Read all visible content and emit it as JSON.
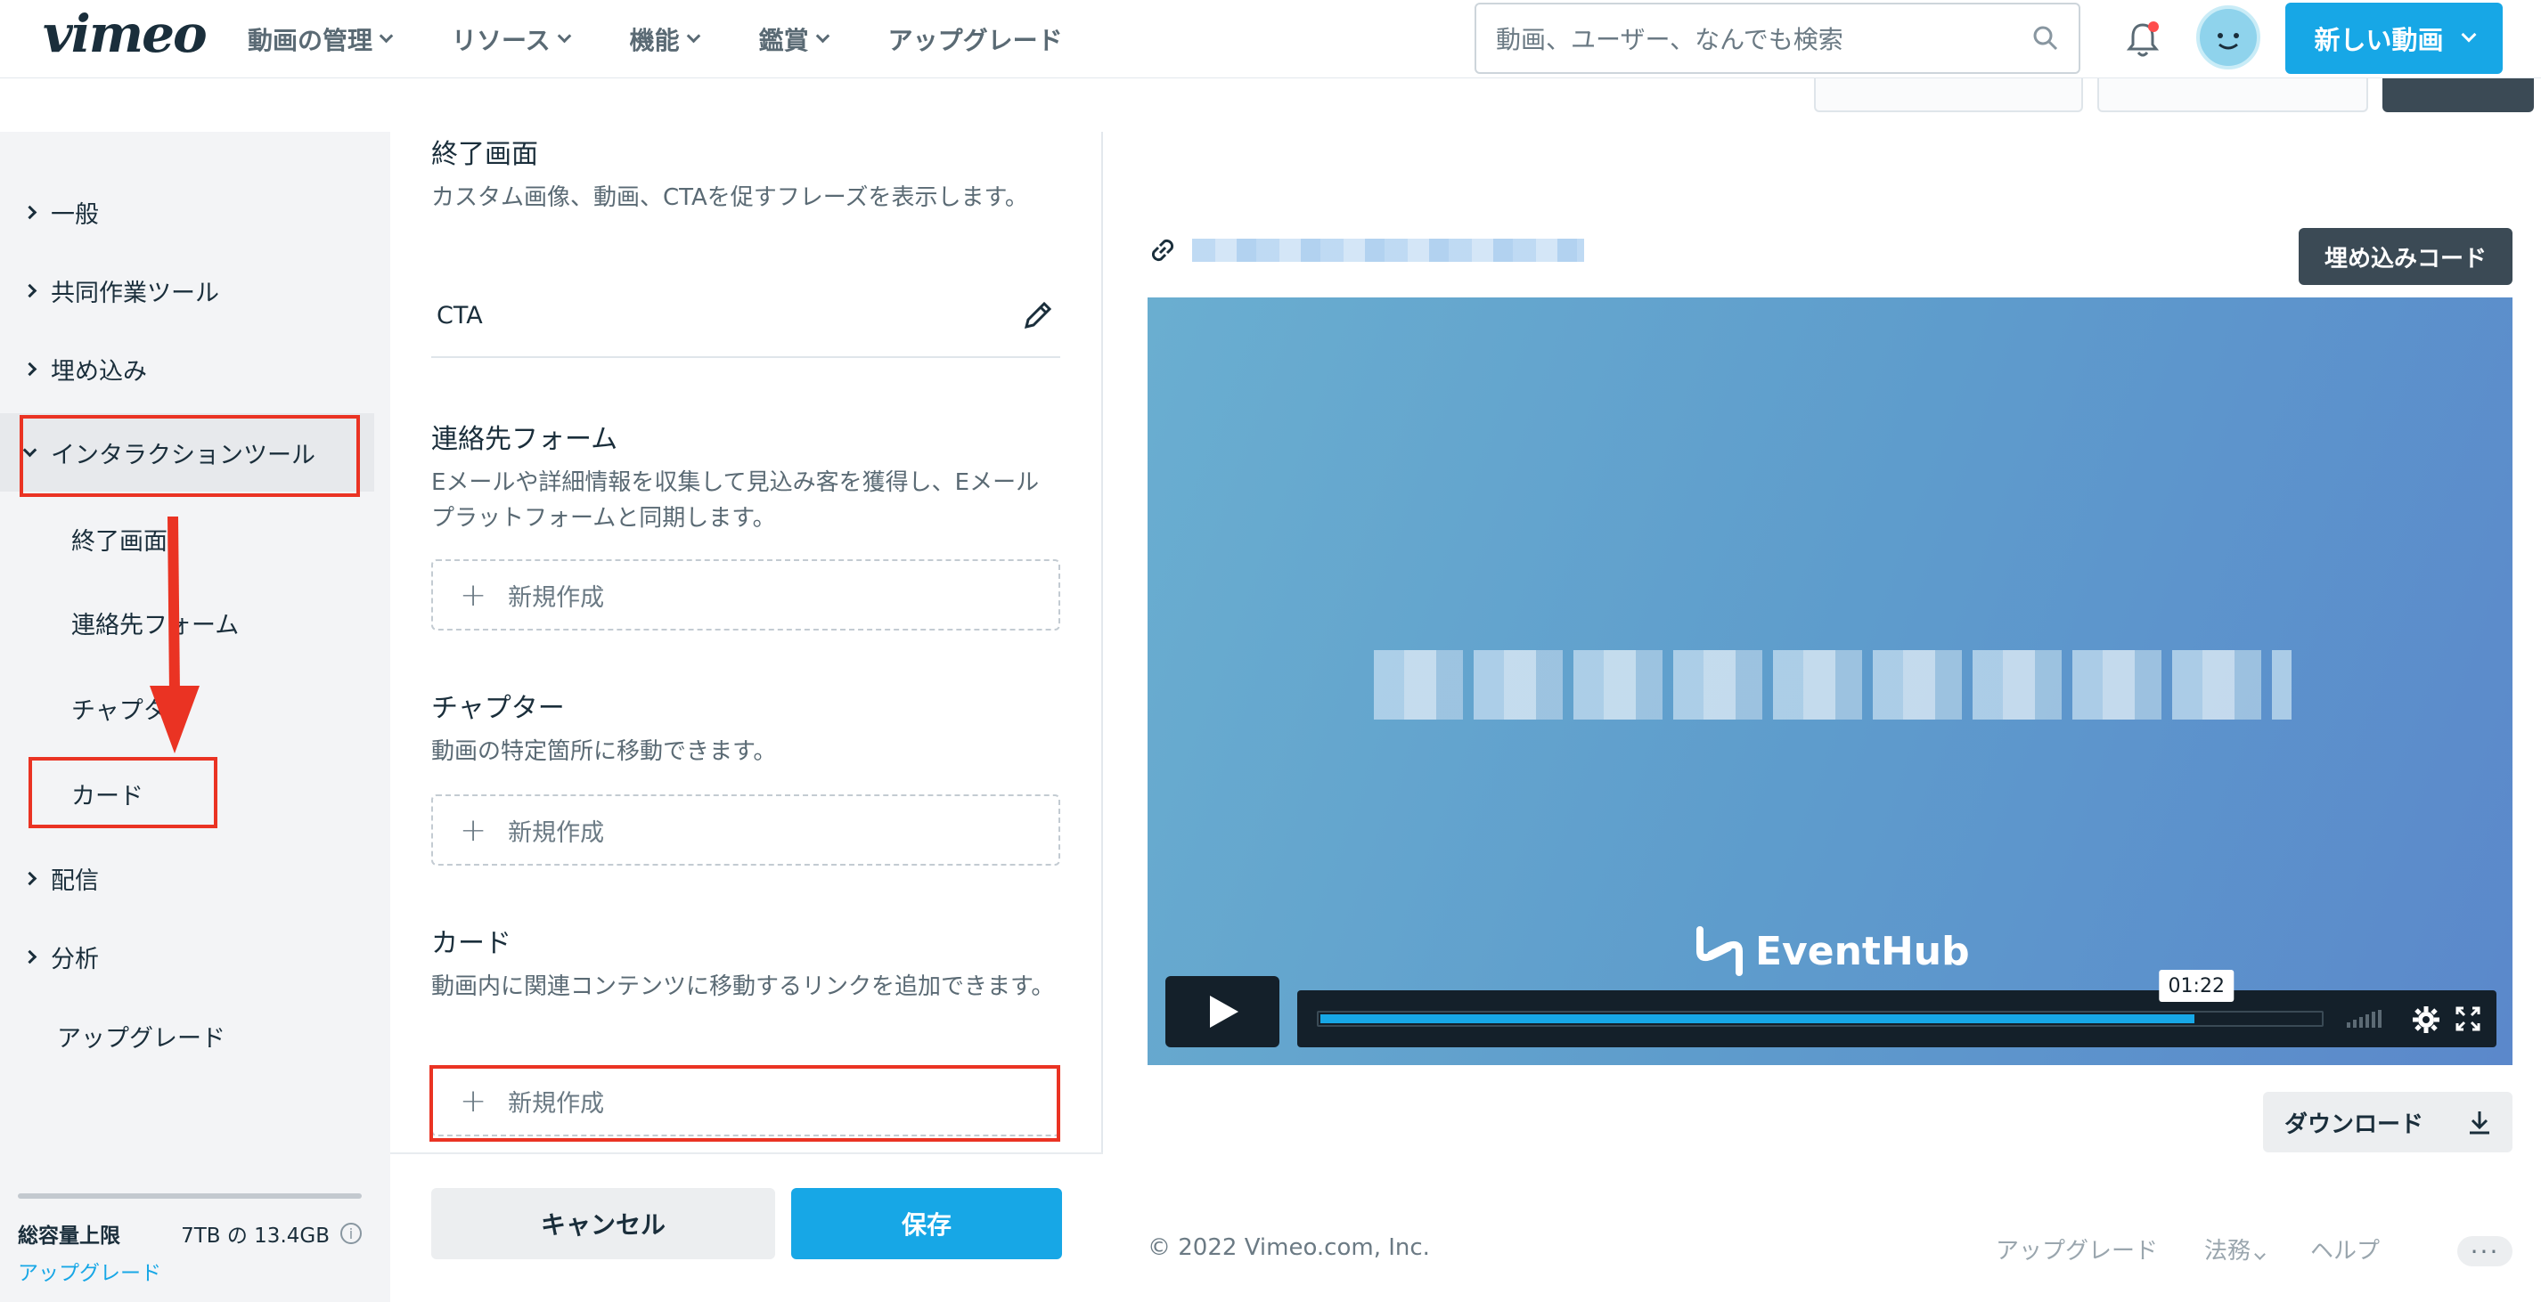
{
  "header": {
    "logo": "vimeo",
    "nav": [
      "動画の管理",
      "リソース",
      "機能",
      "鑑賞",
      "アップグレード"
    ],
    "search_placeholder": "動画、ユーザー、なんでも検索",
    "new_video_label": "新しい動画"
  },
  "sidebar": {
    "items": [
      {
        "label": "一般"
      },
      {
        "label": "共同作業ツール"
      },
      {
        "label": "埋め込み"
      },
      {
        "label": "インタラクションツール"
      }
    ],
    "sub_items": [
      "終了画面",
      "連絡先フォーム",
      "チャプター",
      "カード"
    ],
    "items_after": [
      {
        "label": "配信"
      },
      {
        "label": "分析"
      }
    ],
    "upgrade": "アップグレード",
    "storage": {
      "label": "総容量上限",
      "value": "7TB の 13.4GB",
      "upgrade_link": "アップグレード"
    }
  },
  "middle": {
    "end_screen": {
      "title": "終了画面",
      "desc": "カスタム画像、動画、CTAを促すフレーズを表示します。",
      "item": "CTA"
    },
    "contact_form": {
      "title": "連絡先フォーム",
      "desc": "Eメールや詳細情報を収集して見込み客を獲得し、Eメールプラットフォームと同期します。",
      "new_label": "新規作成"
    },
    "chapters": {
      "title": "チャプター",
      "desc": "動画の特定箇所に移動できます。",
      "new_label": "新規作成"
    },
    "cards": {
      "title": "カード",
      "desc": "動画内に関連コンテンツに移動するリンクを追加できます。",
      "new_label": "新規作成"
    },
    "cancel_label": "キャンセル",
    "save_label": "保存"
  },
  "right": {
    "embed_code_label": "埋め込みコード",
    "video": {
      "brand": "EventHub",
      "time": "01:22",
      "progress_percent": 87.5
    },
    "download_label": "ダウンロード",
    "footer": {
      "copyright": "© 2022 Vimeo.com, Inc.",
      "links": [
        "アップグレード",
        "法務",
        "ヘルプ"
      ]
    }
  },
  "colors": {
    "accent": "#17a7e6",
    "annotation": "#ea3323",
    "text": "#1a2e3b"
  }
}
